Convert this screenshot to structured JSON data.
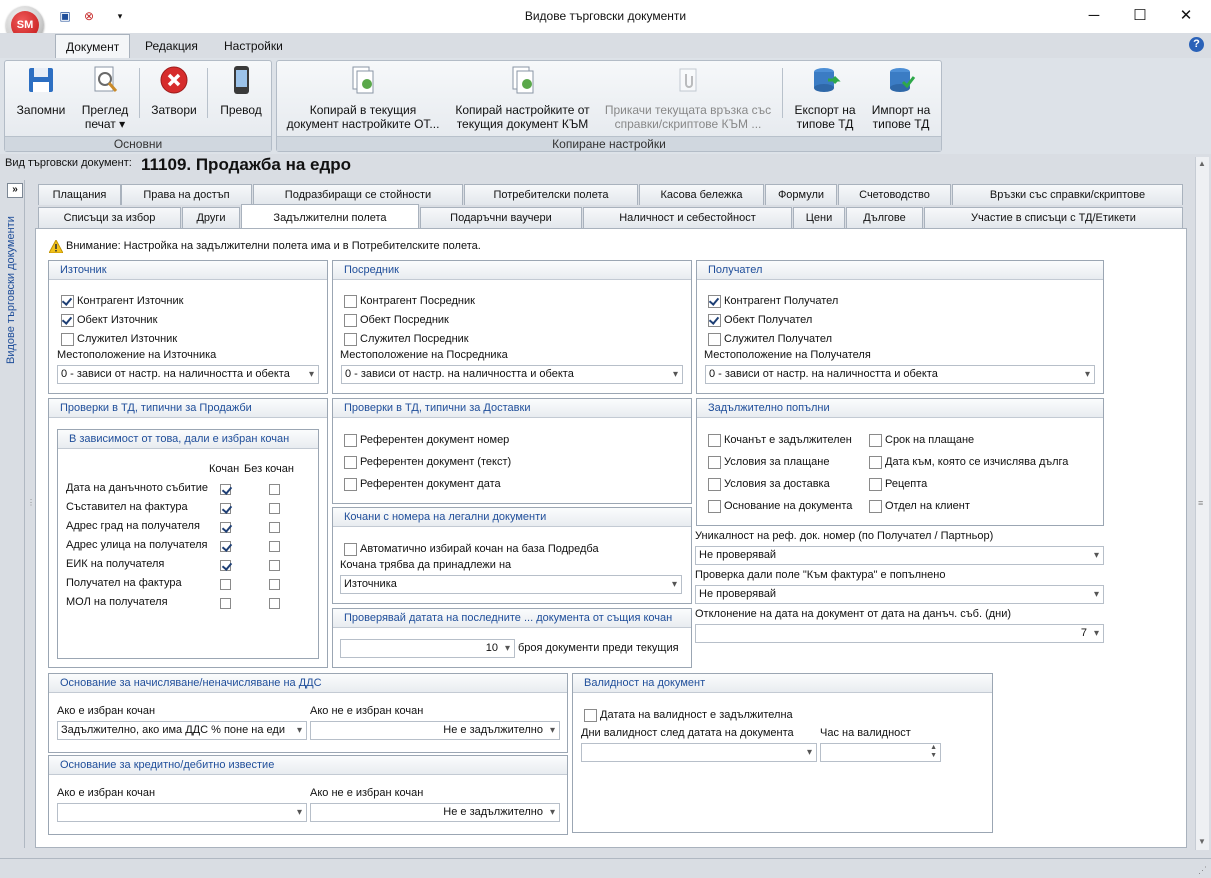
{
  "window": {
    "title": "Видове търговски документи",
    "logo": "SM",
    "min": "─",
    "max": "☐",
    "close": "✕"
  },
  "ribbon": {
    "tabs": [
      "Документ",
      "Редакция",
      "Настройки"
    ],
    "groups": {
      "basic": "Основни",
      "copy": "Копиране настройки"
    },
    "buttons": {
      "save": "Запомни",
      "preview_l1": "Преглед",
      "preview_l2": "печат ▾",
      "close": "Затвори",
      "translate": "Превод",
      "copy_to_l1": "Копирай в текущия",
      "copy_to_l2": "документ настройките ОТ...",
      "copy_from_l1": "Копирай настройките от",
      "copy_from_l2": "текущия документ КЪМ",
      "attach_l1": "Прикачи текущата връзка със",
      "attach_l2": "справки/скриптове КЪМ ...",
      "export_l1": "Експорт на",
      "export_l2": "типове ТД",
      "import_l1": "Импорт на",
      "import_l2": "типове ТД"
    }
  },
  "doc": {
    "label": "Вид търговски документ:",
    "name": "11109. Продажба на едро"
  },
  "sidebar": {
    "label": "Видове търговски документи",
    "toggle": "»"
  },
  "tabs_row1": [
    "Плащания",
    "Права на достъп",
    "Подразбиращи се стойности",
    "Потребителски полета",
    "Касова бележка",
    "Формули",
    "Счетоводство",
    "Връзки със справки/скриптове"
  ],
  "tabs_row2": [
    "Списъци за избор",
    "Други",
    "Задължителни полета",
    "Подаръчни ваучери",
    "Наличност и себестойност",
    "Цени",
    "Дългове",
    "Участие в списъци с ТД/Етикети"
  ],
  "warning": "Внимание: Настройка на задължителни полета има и в Потребителските полета.",
  "source": {
    "title": "Източник",
    "items": [
      {
        "label": "Контрагент Източник",
        "checked": true
      },
      {
        "label": "Обект Източник",
        "checked": true
      },
      {
        "label": "Служител Източник",
        "checked": false
      }
    ],
    "location_label": "Местоположение на Източника",
    "location": "0 - зависи от настр. на наличността и обекта"
  },
  "mediator": {
    "title": "Посредник",
    "items": [
      {
        "label": "Контрагент Посредник",
        "checked": false
      },
      {
        "label": "Обект Посредник",
        "checked": false
      },
      {
        "label": "Служител Посредник",
        "checked": false
      }
    ],
    "location_label": "Местоположение на Посредника",
    "location": "0 - зависи от настр. на наличността и обекта"
  },
  "receiver": {
    "title": "Получател",
    "items": [
      {
        "label": "Контрагент Получател",
        "checked": true
      },
      {
        "label": "Обект Получател",
        "checked": true
      },
      {
        "label": "Служител Получател",
        "checked": false
      }
    ],
    "location_label": "Местоположение на Получателя",
    "location": "0 - зависи от настр. на наличността и обекта"
  },
  "sales": {
    "title": "Проверки в ТД, типични за Продажби",
    "sub": "В зависимост от това, дали е избран кочан",
    "col1": "Кочан",
    "col2": "Без кочан",
    "rows": [
      {
        "label": "Дата на данъчното събитие",
        "a": true,
        "b": false
      },
      {
        "label": "Съставител на фактура",
        "a": true,
        "b": false
      },
      {
        "label": "Адрес град на получателя",
        "a": true,
        "b": false
      },
      {
        "label": "Адрес улица на получателя",
        "a": true,
        "b": false
      },
      {
        "label": "ЕИК на получателя",
        "a": true,
        "b": false
      },
      {
        "label": "Получател на фактура",
        "a": false,
        "b": false
      },
      {
        "label": "МОЛ на получателя",
        "a": false,
        "b": false
      }
    ]
  },
  "deliveries": {
    "title": "Проверки в ТД, типични за Доставки",
    "items": [
      "Референтен документ номер",
      "Референтен документ (текст)",
      "Референтен документ дата"
    ]
  },
  "books": {
    "title": "Кочани с номера на легални документи",
    "auto": "Автоматично избирай кочан на база Подредба",
    "belong_label": "Кочана трябва да принадлежи на",
    "belong": "Източника"
  },
  "lastdocs": {
    "title": "Проверявай датата на последните ... документа от същия кочан",
    "value": "10",
    "suffix": "броя документи преди текущия"
  },
  "required": {
    "title": "Задължително попълни",
    "left": [
      "Кочанът е задължителен",
      "Условия за плащане",
      "Условия за доставка",
      "Основание на документа"
    ],
    "right": [
      "Срок на плащане",
      "Дата към, която се изчислява дълга",
      "Рецепта",
      "Отдел на клиент"
    ]
  },
  "uniq": {
    "label": "Уникалност на реф. док. номер (по Получател / Партньор)",
    "value": "Не проверявай"
  },
  "invoicechk": {
    "label": "Проверка дали поле \"Към фактура\" е попълнено",
    "value": "Не проверявай"
  },
  "deviation": {
    "label": "Отклонение на дата на документ от дата на данъч. съб. (дни)",
    "value": "7"
  },
  "vat": {
    "title": "Основание за начисляване/неначисляване на ДДС",
    "l1": "Ако е избран кочан",
    "v1": "Задължително, ако има ДДС % поне на еди",
    "l2": "Ако не е избран кочан",
    "v2": "Не е задължително"
  },
  "credit": {
    "title": "Основание за кредитно/дебитно известие",
    "l1": "Ако е избран кочан",
    "v1": "",
    "l2": "Ако не е избран кочан",
    "v2": "Не е задължително"
  },
  "validity": {
    "title": "Валидност на документ",
    "chk": "Датата на валидност е задължителна",
    "days": "Дни валидност след датата на документа",
    "hour": "Час на валидност"
  }
}
